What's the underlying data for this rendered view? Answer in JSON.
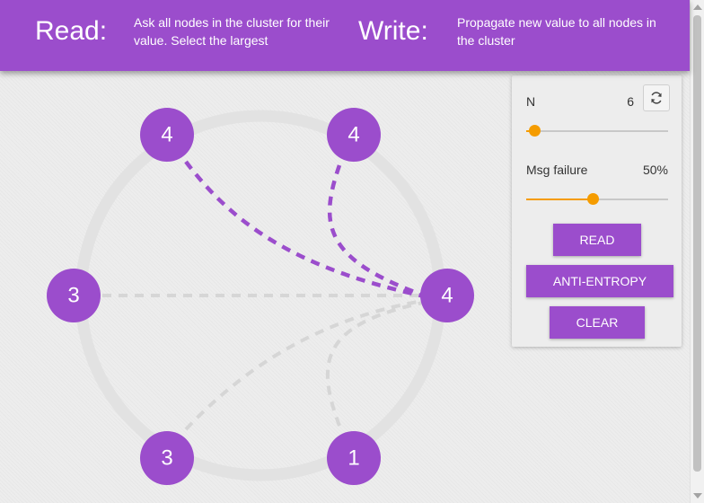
{
  "header": {
    "read_title": "Read:",
    "read_description": "Ask all nodes in the cluster for their value. Select the largest",
    "write_title": "Write:",
    "write_description": "Propagate new value to all nodes in the cluster"
  },
  "diagram": {
    "node_color": "#9b4dcc",
    "ring_color": "#e2e2e2",
    "active_link_color": "#9b4dcc",
    "inactive_link_color": "#d6d6d6",
    "nodes": [
      {
        "id": "node-top-left",
        "value": "4"
      },
      {
        "id": "node-top-right",
        "value": "4"
      },
      {
        "id": "node-right",
        "value": "4"
      },
      {
        "id": "node-bottom-right",
        "value": "1"
      },
      {
        "id": "node-bottom-left",
        "value": "3"
      },
      {
        "id": "node-left",
        "value": "3"
      }
    ],
    "links": [
      {
        "from": "node-top-left",
        "to": "node-right",
        "active": true
      },
      {
        "from": "node-top-right",
        "to": "node-right",
        "active": true
      },
      {
        "from": "node-left",
        "to": "node-right",
        "active": false
      },
      {
        "from": "node-bottom-left",
        "to": "node-right",
        "active": false
      },
      {
        "from": "node-bottom-right",
        "to": "node-right",
        "active": false
      }
    ]
  },
  "controls": {
    "n_label": "N",
    "n_value": "6",
    "n_slider_fraction": 0.06,
    "refresh_icon": "refresh-icon",
    "msg_failure_label": "Msg failure",
    "msg_failure_value": "50%",
    "msg_failure_fraction": 0.47,
    "slider_color": "#f59c00",
    "read_button": "READ",
    "anti_entropy_button": "ANTI-ENTROPY",
    "clear_button": "CLEAR",
    "button_color": "#9b4dcc"
  }
}
